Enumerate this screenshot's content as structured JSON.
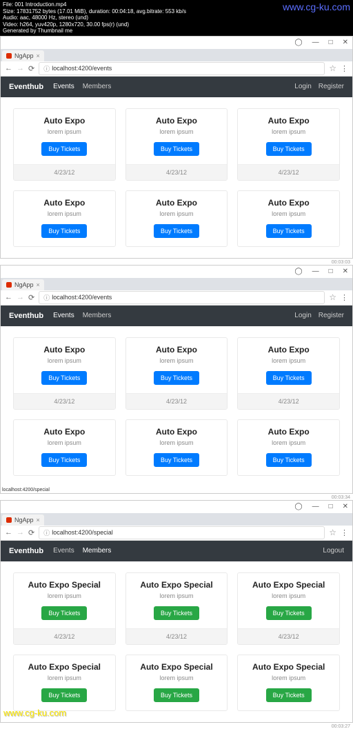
{
  "meta": {
    "line1": "File: 001 Introduction.mp4",
    "line2": "Size: 17831752 bytes (17.01 MiB), duration: 00:04:18, avg.bitrate: 553 kb/s",
    "line3": "Audio: aac, 48000 Hz, stereo (und)",
    "line4": "Video: h264, yuv420p, 1280x720, 30.00 fps(r) (und)",
    "line5": "Generated by Thumbnail me",
    "watermark": "www.cg-ku.com"
  },
  "windows": [
    {
      "tab": "NgApp",
      "url": "localhost:4200/events",
      "brand": "Eventhub",
      "nav": {
        "events": "Events",
        "members": "Members",
        "activeIndex": 0
      },
      "right": [
        "Login",
        "Register"
      ],
      "button_style": "blue",
      "button_label": "Buy Tickets",
      "cards": [
        {
          "title": "Auto Expo",
          "sub": "lorem ipsum",
          "date": "4/23/12"
        },
        {
          "title": "Auto Expo",
          "sub": "lorem ipsum",
          "date": "4/23/12"
        },
        {
          "title": "Auto Expo",
          "sub": "lorem ipsum",
          "date": "4/23/12"
        },
        {
          "title": "Auto Expo",
          "sub": "lorem ipsum",
          "date": ""
        },
        {
          "title": "Auto Expo",
          "sub": "lorem ipsum",
          "date": ""
        },
        {
          "title": "Auto Expo",
          "sub": "lorem ipsum",
          "date": ""
        }
      ],
      "status": "",
      "timestamp": "00:03:03"
    },
    {
      "tab": "NgApp",
      "url": "localhost:4200/events",
      "brand": "Eventhub",
      "nav": {
        "events": "Events",
        "members": "Members",
        "activeIndex": 0
      },
      "right": [
        "Login",
        "Register"
      ],
      "button_style": "blue",
      "button_label": "Buy Tickets",
      "cards": [
        {
          "title": "Auto Expo",
          "sub": "lorem ipsum",
          "date": "4/23/12"
        },
        {
          "title": "Auto Expo",
          "sub": "lorem ipsum",
          "date": "4/23/12"
        },
        {
          "title": "Auto Expo",
          "sub": "lorem ipsum",
          "date": "4/23/12"
        },
        {
          "title": "Auto Expo",
          "sub": "lorem ipsum",
          "date": ""
        },
        {
          "title": "Auto Expo",
          "sub": "lorem ipsum",
          "date": ""
        },
        {
          "title": "Auto Expo",
          "sub": "lorem ipsum",
          "date": ""
        }
      ],
      "status": "localhost:4200/special",
      "timestamp": "00:03:34"
    },
    {
      "tab": "NgApp",
      "url": "localhost:4200/special",
      "brand": "Eventhub",
      "nav": {
        "events": "Events",
        "members": "Members",
        "activeIndex": 1
      },
      "right": [
        "Logout"
      ],
      "button_style": "green",
      "button_label": "Buy Tickets",
      "cards": [
        {
          "title": "Auto Expo Special",
          "sub": "lorem ipsum",
          "date": "4/23/12"
        },
        {
          "title": "Auto Expo Special",
          "sub": "lorem ipsum",
          "date": "4/23/12"
        },
        {
          "title": "Auto Expo Special",
          "sub": "lorem ipsum",
          "date": "4/23/12"
        },
        {
          "title": "Auto Expo Special",
          "sub": "lorem ipsum",
          "date": ""
        },
        {
          "title": "Auto Expo Special",
          "sub": "lorem ipsum",
          "date": ""
        },
        {
          "title": "Auto Expo Special",
          "sub": "lorem ipsum",
          "date": ""
        }
      ],
      "status": "",
      "timestamp": "00:03:27"
    }
  ],
  "bottom_watermark": "www.cg-ku.com",
  "window_icons": {
    "user": "◯",
    "min": "—",
    "max": "□",
    "close": "✕"
  }
}
